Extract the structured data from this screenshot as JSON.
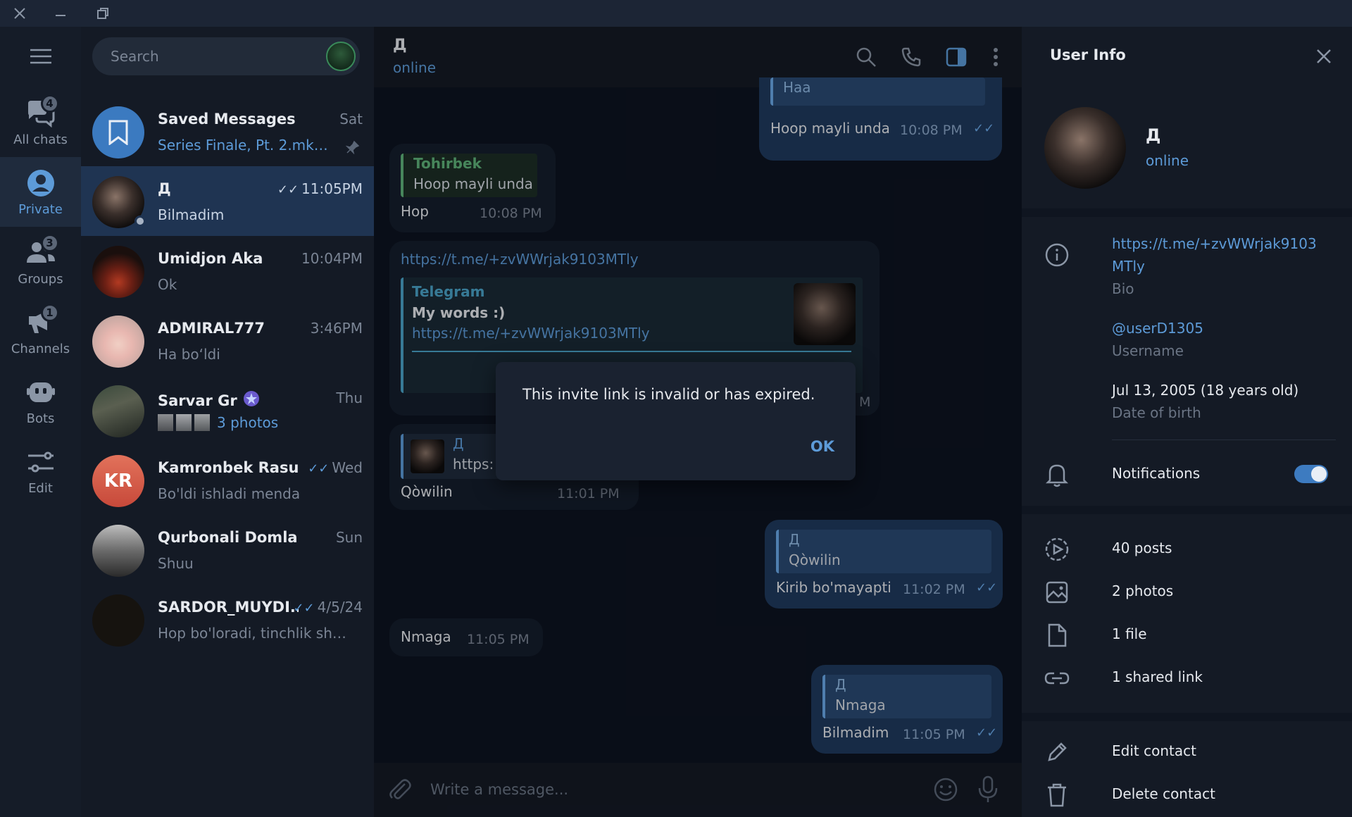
{
  "colors": {
    "accent": "#5d9bd8",
    "active_row": "#1f3452",
    "outgoing_bubble": "#1f3a5e",
    "incoming_bubble": "#151e2c"
  },
  "rail": {
    "items": [
      {
        "label": "All chats",
        "icon": "chats-icon",
        "badge": "4"
      },
      {
        "label": "Private",
        "icon": "person-icon",
        "badge": ""
      },
      {
        "label": "Groups",
        "icon": "group-icon",
        "badge": "3"
      },
      {
        "label": "Channels",
        "icon": "megaphone-icon",
        "badge": "1"
      },
      {
        "label": "Bots",
        "icon": "bot-icon",
        "badge": ""
      },
      {
        "label": "Edit",
        "icon": "sliders-icon",
        "badge": ""
      }
    ]
  },
  "search": {
    "placeholder": "Search"
  },
  "chats": [
    {
      "name": "Saved Messages",
      "time": "Sat",
      "preview": "Series Finale, Pt. 2.mkv, ..."
    },
    {
      "name": "Д",
      "time": "11:05PM",
      "preview": "Bilmadim"
    },
    {
      "name": "Umidjon Aka",
      "time": "10:04PM",
      "preview": "Ok"
    },
    {
      "name": "ADMIRAL777",
      "time": "3:46PM",
      "preview": "Ha bo‘ldi"
    },
    {
      "name": "Sarvar Gr",
      "time": "Thu",
      "preview": "3 photos"
    },
    {
      "name": "Kamronbek Rasul...",
      "time": "Wed",
      "preview": "Bo'ldi ishladi menda",
      "initials": "KR"
    },
    {
      "name": "Qurbonali Domla",
      "time": "Sun",
      "preview": "Shuu"
    },
    {
      "name": "SARDOR_MUYDI...",
      "time": "4/5/24",
      "preview": "Hop bo'loradi, tinchlik sheki..."
    }
  ],
  "conversation": {
    "name": "Д",
    "status": "online",
    "messages": {
      "m1": {
        "reply_name": "Haa",
        "text": "Hoop mayli unda",
        "time": "10:08 PM"
      },
      "m2": {
        "reply_name": "Tohirbek",
        "reply_text": "Hoop mayli unda",
        "text": "Hop",
        "time": "10:08 PM"
      },
      "m3": {
        "link": "https://t.me/+zvWWrjak9103MTly",
        "preview_site": "Telegram",
        "preview_title": "My words :)",
        "preview_link": "https://t.me/+zvWWrjak9103MTly",
        "time_fragment": "M"
      },
      "m4": {
        "reply_name": "Д",
        "reply_text": "https:",
        "text": "Qòwilin",
        "time": "11:01 PM"
      },
      "m5": {
        "reply_name": "Д",
        "reply_text": "Qòwilin",
        "text": "Kirib bo'mayapti",
        "time": "11:02 PM"
      },
      "m6": {
        "text": "Nmaga",
        "time": "11:05 PM"
      },
      "m7": {
        "reply_name": "Д",
        "reply_text": "Nmaga",
        "text": "Bilmadim",
        "time": "11:05 PM"
      }
    },
    "composer_placeholder": "Write a message..."
  },
  "dialog": {
    "text": "This invite link is invalid or has expired.",
    "ok": "OK"
  },
  "info": {
    "title": "User Info",
    "name": "Д",
    "status": "online",
    "bio_link": "https://t.me/+zvWWrjak9103",
    "bio_link_2": "MTly",
    "bio_label": "Bio",
    "username": "@userD1305",
    "username_label": "Username",
    "dob": "Jul 13, 2005 (18 years old)",
    "dob_label": "Date of birth",
    "notifications": "Notifications",
    "notifications_on": true,
    "posts": "40 posts",
    "photos": "2 photos",
    "files": "1 file",
    "links": "1 shared link",
    "edit": "Edit contact",
    "delete": "Delete contact"
  }
}
